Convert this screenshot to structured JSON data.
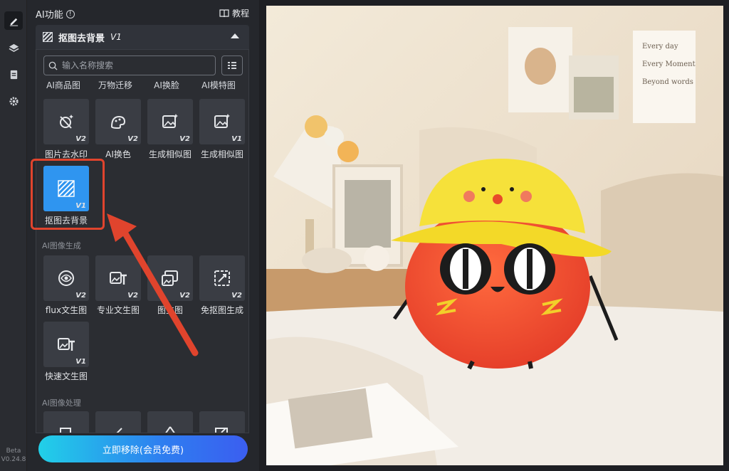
{
  "panel": {
    "title": "AI功能",
    "info_icon": "info-icon",
    "tutorial_label": "教程",
    "section_title": "抠图去背景",
    "section_version": "V1"
  },
  "search": {
    "placeholder": "输入名称搜索"
  },
  "top_row_labels": [
    "AI商品图",
    "万物迁移",
    "AI换脸",
    "AI模特图"
  ],
  "tools_row1": [
    {
      "label": "图片去水印",
      "badge": "V2",
      "icon": "watermark-remove-icon"
    },
    {
      "label": "AI换色",
      "badge": "V2",
      "icon": "color-swap-icon"
    },
    {
      "label": "生成相似图",
      "badge": "V2",
      "icon": "image-sparkle-icon"
    },
    {
      "label": "生成相似图",
      "badge": "V1",
      "icon": "image-sparkle-icon"
    }
  ],
  "tools_row2": [
    {
      "label": "抠图去背景",
      "badge": "V1",
      "icon": "cutout-icon",
      "selected": true
    }
  ],
  "group_generate": "AI图像生成",
  "tools_row3": [
    {
      "label": "flux文生图",
      "badge": "V2",
      "icon": "flux-icon"
    },
    {
      "label": "专业文生图",
      "badge": "V2",
      "icon": "text-to-image-icon"
    },
    {
      "label": "图生图",
      "badge": "V2",
      "icon": "image-to-image-icon"
    },
    {
      "label": "免抠图生成",
      "badge": "V2",
      "icon": "no-cutout-icon"
    }
  ],
  "tools_row4": [
    {
      "label": "快速文生图",
      "badge": "V1",
      "icon": "text-to-image-icon"
    }
  ],
  "group_process": "AI图像处理",
  "cta_label": "立即移除(会员免费)",
  "version": {
    "beta": "Beta",
    "number": "V0.24.8"
  },
  "photo": {
    "card_lines": [
      "Every day",
      "Every Moment",
      "Beyond words"
    ]
  },
  "colors": {
    "accent": "#2f95f0",
    "highlight": "#e0442d",
    "cta_start": "#21d0e8",
    "cta_end": "#3b5ef0"
  }
}
